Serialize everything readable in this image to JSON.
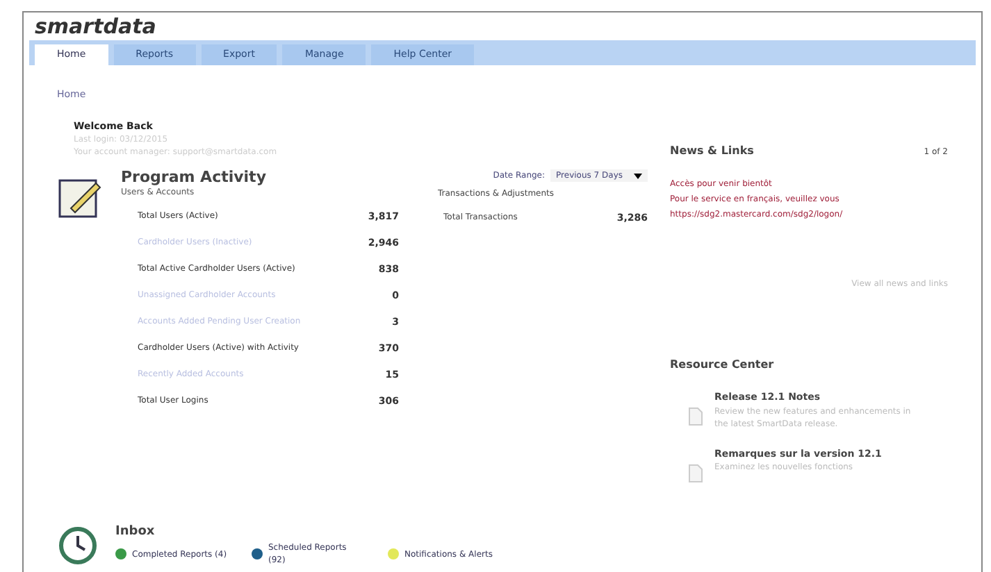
{
  "logo": "smartdata",
  "tabs": [
    {
      "label": "Home",
      "selected": true
    },
    {
      "label": "Reports",
      "selected": false
    },
    {
      "label": "Export",
      "selected": false
    },
    {
      "label": "Manage",
      "selected": false
    },
    {
      "label": "Help Center",
      "selected": false
    }
  ],
  "breadcrumb": "Home",
  "welcome": {
    "title": "Welcome Back",
    "lines": [
      "Last login: 03/12/2015",
      "Your account manager: support@smartdata.com"
    ]
  },
  "activity": {
    "title": "Program Activity",
    "subtitle": "Users & Accounts",
    "rows": [
      {
        "label": "Total Users (Active)",
        "value": "3,817",
        "kind": "text"
      },
      {
        "label": "Cardholder Users (Inactive)",
        "value": "2,946",
        "kind": "link"
      },
      {
        "label": "Total Active Cardholder Users (Active)",
        "value": "838",
        "kind": "text"
      },
      {
        "label": "Unassigned Cardholder Accounts",
        "value": "0",
        "kind": "link"
      },
      {
        "label": "Accounts Added Pending User Creation",
        "value": "3",
        "kind": "link"
      },
      {
        "label": "Cardholder Users (Active) with Activity",
        "value": "370",
        "kind": "text"
      },
      {
        "label": "Recently Added Accounts",
        "value": "15",
        "kind": "link"
      },
      {
        "label": "Total User Logins",
        "value": "306",
        "kind": "text"
      }
    ]
  },
  "date_range": {
    "label": "Date Range:",
    "value": "Previous 7 Days"
  },
  "transactions": {
    "title": "Transactions & Adjustments",
    "rows": [
      {
        "label": "Total Transactions",
        "value": "3,286"
      }
    ]
  },
  "news": {
    "title": "News & Links",
    "pager": "1 of 2",
    "lines": [
      "Accès pour venir bientôt",
      "Pour le service en français, veuillez vous",
      "https://sdg2.mastercard.com/sdg2/logon/"
    ],
    "footer": "View all news and links"
  },
  "resources": {
    "title": "Resource Center",
    "items": [
      {
        "title": "Release 12.1 Notes",
        "description": "Review the new features and enhancements in the latest SmartData release."
      },
      {
        "title": "Remarques sur la version 12.1",
        "description": "Examinez les nouvelles fonctions"
      }
    ]
  },
  "inbox": {
    "title": "Inbox",
    "items": [
      {
        "label": "Completed Reports (4)",
        "color": "#3a9a48"
      },
      {
        "label": "Scheduled Reports (92)",
        "color": "#1f5f8a"
      },
      {
        "label": "Notifications & Alerts",
        "color": "#e2e85a"
      }
    ]
  }
}
